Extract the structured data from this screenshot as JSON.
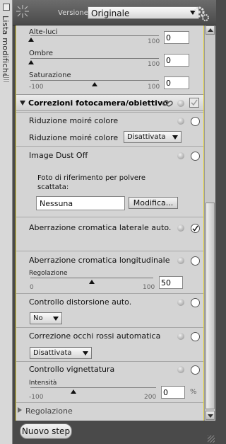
{
  "side": {
    "label": "Lista modifiche"
  },
  "header": {
    "version_label": "Versione",
    "version_value": "Originale"
  },
  "top": {
    "alte_luci": {
      "label": "Alte-luci",
      "min": "",
      "max": "100",
      "value": "0"
    },
    "ombre": {
      "label": "Ombre",
      "min": "",
      "max": "100",
      "value": "0"
    },
    "saturazione": {
      "label": "Saturazione",
      "min": "-100",
      "max": "100",
      "value": "0"
    }
  },
  "section": {
    "title": "Correzioni fotocamera/obiettivo"
  },
  "moire": {
    "title": "Riduzione moiré colore",
    "sub_label": "Riduzione moiré colore",
    "dropdown": "Disattivata"
  },
  "dust": {
    "title": "Image Dust Off",
    "caption": "Foto di riferimento per polvere scattata:",
    "field_value": "Nessuna",
    "button": "Modifica..."
  },
  "aberr_lat": {
    "title": "Aberrazione cromatica laterale auto."
  },
  "aberr_long": {
    "title": "Aberrazione cromatica longitudinale",
    "slider_label": "Regolazione",
    "min": "0",
    "max": "100",
    "value": "50"
  },
  "distort": {
    "title": "Controllo distorsione auto.",
    "dropdown": "No"
  },
  "redeye": {
    "title": "Correzione occhi rossi automatica",
    "dropdown": "Disattivata"
  },
  "vignette": {
    "title": "Controllo vignettatura",
    "slider_label": "Intensità",
    "min": "-100",
    "max": "200",
    "value": "0",
    "unit": "%"
  },
  "footer": {
    "collapsed_label": "Regolazione",
    "new_step_button": "Nuovo step"
  }
}
